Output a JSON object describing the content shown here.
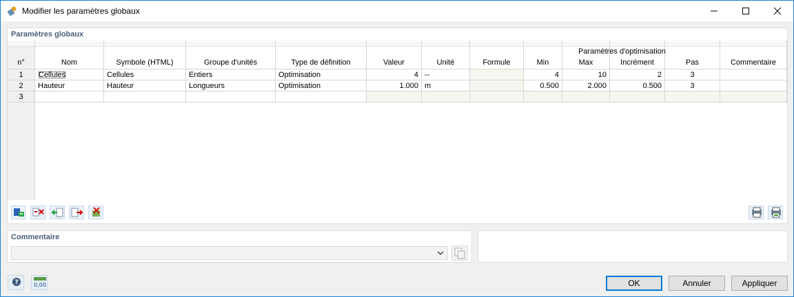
{
  "window": {
    "title": "Modifier les paramètres globaux"
  },
  "panel_title": "Paramètres globaux",
  "opt_group_label": "Paramètres d'optimisation",
  "columns": [
    "n°",
    "Nom",
    "Symbole (HTML)",
    "Groupe d'unités",
    "Type de définition",
    "Valeur",
    "Unité",
    "Formule",
    "Min",
    "Max",
    "Incrément",
    "Pas",
    "Commentaire"
  ],
  "rows": [
    {
      "n": "1",
      "nom": "Cellules",
      "symbole": "Cellules",
      "groupe": "Entiers",
      "type": "Optimisation",
      "valeur": "4",
      "unite": "--",
      "formule": "",
      "min": "4",
      "max": "10",
      "increment": "2",
      "pas": "3",
      "commentaire": ""
    },
    {
      "n": "2",
      "nom": "Hauteur",
      "symbole": "Hauteur",
      "groupe": "Longueurs",
      "type": "Optimisation",
      "valeur": "1.000",
      "unite": "m",
      "formule": "",
      "min": "0.500",
      "max": "2.000",
      "increment": "0.500",
      "pas": "3",
      "commentaire": ""
    },
    {
      "n": "3",
      "nom": "",
      "symbole": "",
      "groupe": "",
      "type": "",
      "valeur": "",
      "unite": "",
      "formule": "",
      "min": "",
      "max": "",
      "increment": "",
      "pas": "",
      "commentaire": ""
    }
  ],
  "toolbar_icons": [
    "insert-row-icon",
    "delete-row-icon",
    "import-icon",
    "export-icon",
    "delete-all-icon"
  ],
  "right_icons": [
    "print-icon",
    "print-preview-icon"
  ],
  "comment": {
    "title": "Commentaire",
    "value": ""
  },
  "footer_icons": [
    "help-icon",
    "units-icon"
  ],
  "units_icon_label": "0,00",
  "buttons": {
    "ok": "OK",
    "cancel": "Annuler",
    "apply": "Appliquer"
  }
}
